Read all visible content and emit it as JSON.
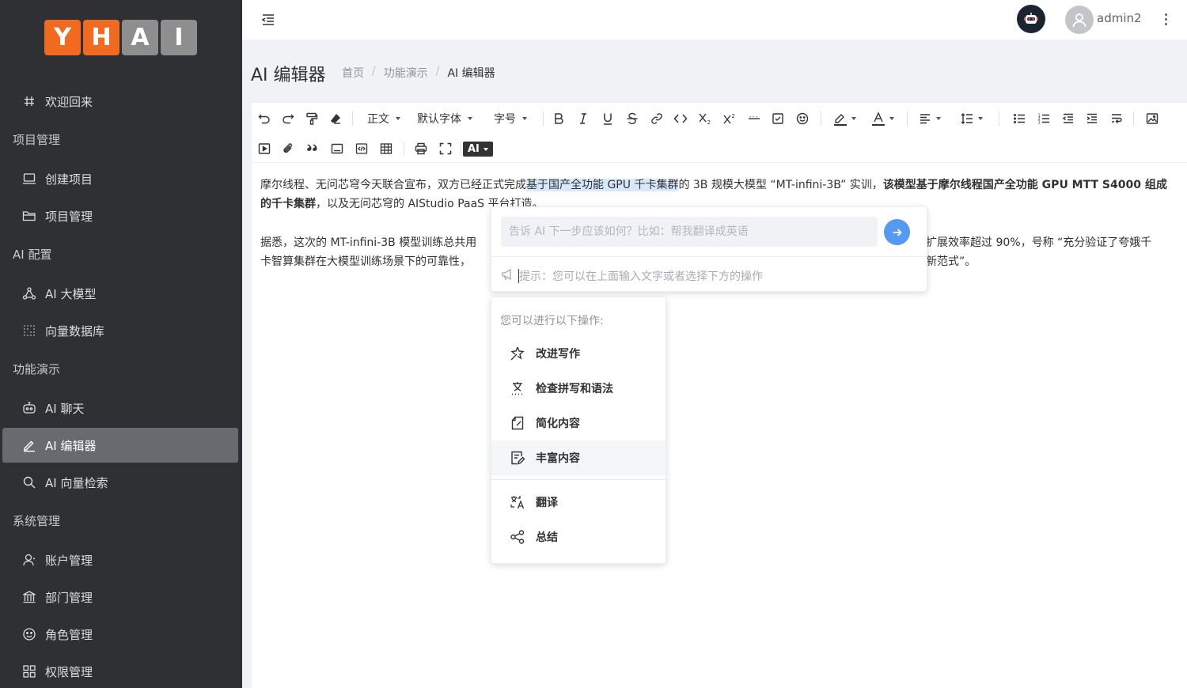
{
  "logo": {
    "letters": [
      "Y",
      "H",
      "A",
      "I"
    ]
  },
  "header": {
    "username": "admin2"
  },
  "sidebar": {
    "items": [
      {
        "type": "item",
        "label": "欢迎回来",
        "icon": "hash-icon"
      },
      {
        "type": "group",
        "label": "项目管理"
      },
      {
        "type": "item",
        "label": "创建项目",
        "icon": "laptop-icon"
      },
      {
        "type": "item",
        "label": "项目管理",
        "icon": "folder-icon"
      },
      {
        "type": "group",
        "label": "AI 配置"
      },
      {
        "type": "item",
        "label": "AI 大模型",
        "icon": "nodes-icon"
      },
      {
        "type": "item",
        "label": "向量数据库",
        "icon": "grid-dots-icon"
      },
      {
        "type": "group",
        "label": "功能演示"
      },
      {
        "type": "item",
        "label": "AI 聊天",
        "icon": "robot-icon"
      },
      {
        "type": "item",
        "label": "AI 编辑器",
        "icon": "pen-icon",
        "active": true
      },
      {
        "type": "item",
        "label": "AI 向量检索",
        "icon": "search-icon"
      },
      {
        "type": "group",
        "label": "系统管理"
      },
      {
        "type": "item",
        "label": "账户管理",
        "icon": "user-icon"
      },
      {
        "type": "item",
        "label": "部门管理",
        "icon": "bank-icon"
      },
      {
        "type": "item",
        "label": "角色管理",
        "icon": "smile-icon"
      },
      {
        "type": "item",
        "label": "权限管理",
        "icon": "apps-icon"
      }
    ]
  },
  "page": {
    "title": "AI 编辑器",
    "breadcrumb": [
      "首页",
      "功能演示",
      "AI 编辑器"
    ]
  },
  "toolbar": {
    "heading": "正文",
    "font_family": "默认字体",
    "font_size": "字号",
    "ai": "AI"
  },
  "content": {
    "p1_a": "摩尔线程、无问芯穹今天联合宣布，双方已经正式完成",
    "p1_hl": "基于国产全功能 GPU 千卡集群",
    "p1_b": "的 3B 规模大模型 “MT-infini-3B” 实训，",
    "p1_bold": "该模型基于摩尔线程国产全功能 GPU MTT S4000 组成的千卡集群",
    "p1_c": "，以及无问芯穹的 AIStudio PaaS 平台打造。",
    "p2_a": "据悉，这次的 MT-infini-3B 模型训练总共用",
    "p2_b": "扩展效率超过 90%，号称 “充分验证了夸娥千",
    "p2_c": "卡智算集群在大模型训练场景下的可靠性，",
    "p2_d": "新范式”。"
  },
  "ai_panel": {
    "placeholder": "告诉 AI 下一步应该如何？比如：帮我翻译成英语",
    "tip": "提示：您可以在上面输入文字或者选择下方的操作"
  },
  "ai_menu": {
    "title": "您可以进行以下操作:",
    "ops": [
      "改进写作",
      "检查拼写和语法",
      "简化内容",
      "丰富内容",
      "翻译",
      "总结"
    ]
  }
}
